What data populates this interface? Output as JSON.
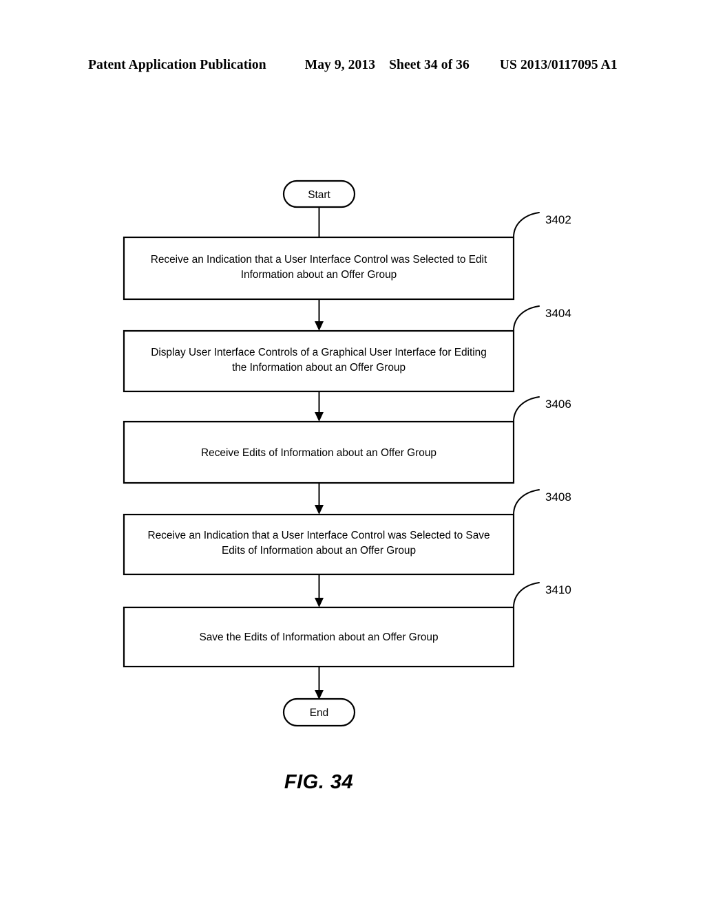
{
  "header": {
    "publication": "Patent Application Publication",
    "date": "May 9, 2013",
    "sheet": "Sheet 34 of 36",
    "patent_number": "US 2013/0117095 A1"
  },
  "figure": {
    "caption": "FIG. 34",
    "start_label": "Start",
    "end_label": "End",
    "steps": [
      {
        "ref": "3402",
        "line1": "Receive an Indication that a User Interface Control was Selected to Edit",
        "line2": "Information about an Offer Group"
      },
      {
        "ref": "3404",
        "line1": "Display User Interface Controls of a Graphical User Interface for Editing",
        "line2": "the Information about an Offer Group"
      },
      {
        "ref": "3406",
        "line1": "Receive Edits of Information about an Offer Group",
        "line2": ""
      },
      {
        "ref": "3408",
        "line1": "Receive an Indication that a User Interface Control was Selected to Save",
        "line2": "Edits of Information about an Offer Group"
      },
      {
        "ref": "3410",
        "line1": "Save the Edits of Information about an Offer Group",
        "line2": ""
      }
    ]
  },
  "colors": {
    "ink": "#000000",
    "paper": "#ffffff"
  }
}
